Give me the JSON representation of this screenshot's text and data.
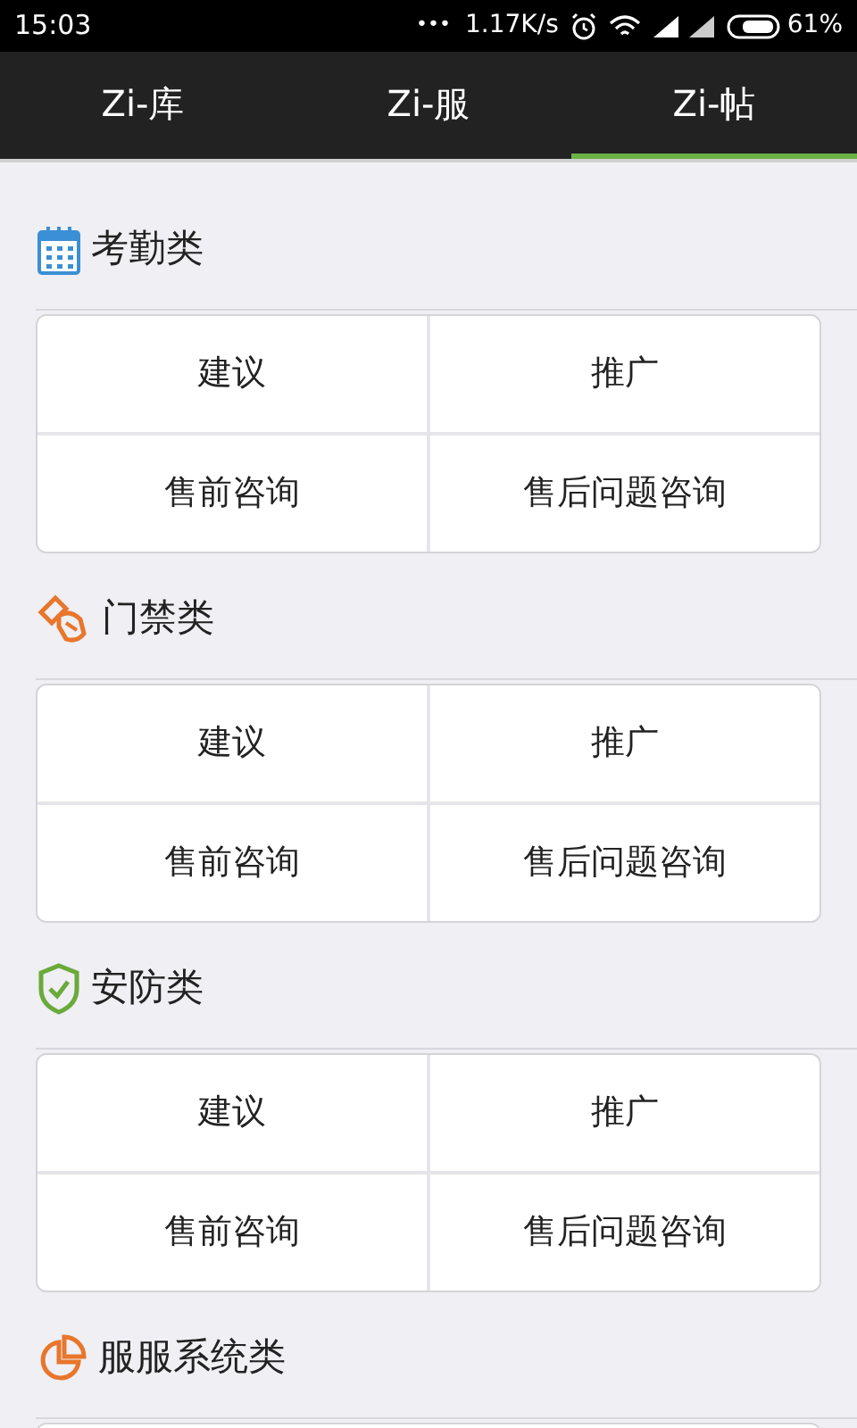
{
  "status_bar": {
    "time": "15:03",
    "dots": "•••",
    "speed": "1.17K/s",
    "battery": "61%"
  },
  "tabs": [
    {
      "label": "Zi-库",
      "selected": false
    },
    {
      "label": "Zi-服",
      "selected": false
    },
    {
      "label": "Zi-帖",
      "selected": true
    }
  ],
  "sections": [
    {
      "title": "考勤类",
      "buttons": [
        "建议",
        "推广",
        "售前咨询",
        "售后问题咨询"
      ]
    },
    {
      "title": "门禁类",
      "buttons": [
        "建议",
        "推广",
        "售前咨询",
        "售后问题咨询"
      ]
    },
    {
      "title": "安防类",
      "buttons": [
        "建议",
        "推广",
        "售前咨询",
        "售后问题咨询"
      ]
    },
    {
      "title": "服服系统类"
    }
  ]
}
